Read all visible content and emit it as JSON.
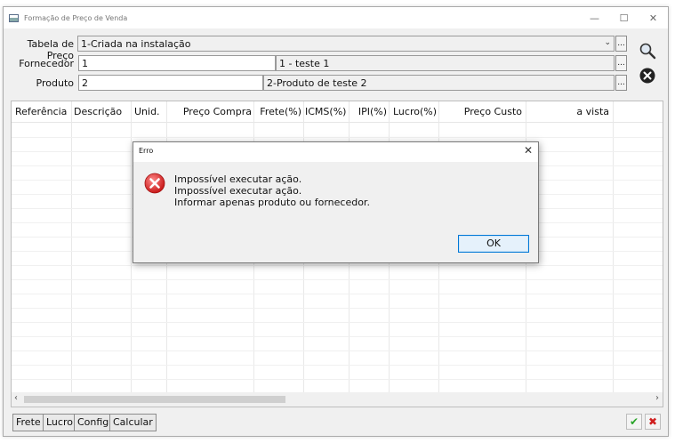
{
  "window": {
    "title": "Formação de Preço de Venda"
  },
  "form": {
    "tabela_label": "Tabela de Preço",
    "tabela_value": "1-Criada na instalação",
    "fornecedor_label": "Fornecedor",
    "fornecedor_code": "1",
    "fornecedor_name": "1 - teste 1",
    "produto_label": "Produto",
    "produto_code": "2",
    "produto_name": "2-Produto de teste 2",
    "lookup_label": "..."
  },
  "grid": {
    "columns": [
      "Referência",
      "Descrição",
      "Unid.",
      "Preço Compra",
      "Frete(%)",
      "ICMS(%)",
      "IPI(%)",
      "Lucro(%)",
      "Preço Custo",
      "a vista"
    ]
  },
  "bottom": {
    "buttons": [
      "Frete",
      "Lucro",
      "Config",
      "Calcular"
    ]
  },
  "dialog": {
    "title": "Erro",
    "lines": [
      "Impossível executar ação.",
      "Impossível executar ação.",
      "Informar apenas produto ou fornecedor."
    ],
    "ok_label": "OK"
  },
  "icons": {
    "search": "magnifier-icon",
    "cancel": "close-circle-icon",
    "confirm": "check-icon",
    "discard": "x-icon",
    "error": "error-icon"
  }
}
